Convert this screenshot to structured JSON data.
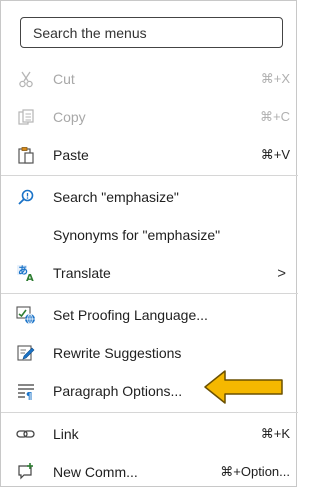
{
  "search": {
    "placeholder": "Search the menus"
  },
  "items": {
    "cut": {
      "label": "Cut",
      "shortcut": "⌘+X"
    },
    "copy": {
      "label": "Copy",
      "shortcut": "⌘+C"
    },
    "paste": {
      "label": "Paste",
      "shortcut": "⌘+V"
    },
    "search_word": {
      "label": "Search \"emphasize\""
    },
    "synonyms": {
      "label": "Synonyms for \"emphasize\""
    },
    "translate": {
      "label": "Translate",
      "chevron": ">"
    },
    "proofing": {
      "label": "Set Proofing Language..."
    },
    "rewrite": {
      "label": "Rewrite Suggestions"
    },
    "paragraph": {
      "label": "Paragraph Options..."
    },
    "link": {
      "label": "Link",
      "shortcut": "⌘+K"
    },
    "new_comment": {
      "label": "New Comm...",
      "shortcut": "⌘+Option..."
    }
  },
  "colors": {
    "accent_blue": "#1a73c8",
    "annotation_arrow_fill": "#f5b800",
    "annotation_arrow_stroke": "#6b5000"
  },
  "icons": {
    "cut": "scissors-icon",
    "copy": "copy-icon",
    "paste": "clipboard-icon",
    "search_word": "search-icon",
    "translate": "translate-icon",
    "proofing": "language-globe-icon",
    "rewrite": "rewrite-pen-icon",
    "paragraph": "paragraph-icon",
    "link": "link-icon",
    "new_comment": "new-comment-icon"
  }
}
